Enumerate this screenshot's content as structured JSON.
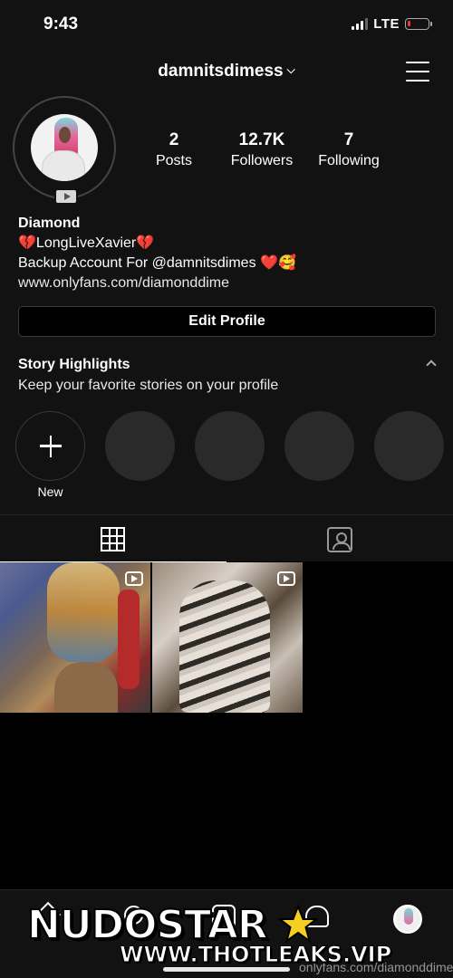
{
  "status_bar": {
    "time": "9:43",
    "network": "LTE"
  },
  "header": {
    "username": "damnitsdimess",
    "chevron": "⌄"
  },
  "stats": {
    "posts": {
      "value": "2",
      "label": "Posts"
    },
    "followers": {
      "value": "12.7K",
      "label": "Followers"
    },
    "following": {
      "value": "7",
      "label": "Following"
    }
  },
  "bio": {
    "name": "Diamond",
    "line1": "💔LongLiveXavier💔",
    "line2": "Backup Account For @damnitsdimes ❤️🥰",
    "link": "www.onlyfans.com/diamonddime"
  },
  "edit_profile_label": "Edit Profile",
  "highlights": {
    "title": "Story Highlights",
    "subtitle": "Keep your favorite stories on your profile",
    "new_label": "New"
  },
  "tabs": [
    {
      "name": "posts-grid",
      "icon": "grid-icon",
      "active": true
    },
    {
      "name": "tagged",
      "icon": "tagged-icon",
      "active": false
    }
  ],
  "posts": [
    {
      "type": "reel",
      "icon": "reel-icon"
    },
    {
      "type": "reel",
      "icon": "reel-icon"
    }
  ],
  "bottom_nav": {
    "icons": [
      "home-icon",
      "search-icon",
      "reels-icon",
      "heart-icon",
      "profile-avatar"
    ]
  },
  "watermark": {
    "logo": "NUDOSTAR",
    "url": "WWW.THOTLEAKS.VIP",
    "faint": "onlyfans.com/diamonddime"
  },
  "colors": {
    "background": "#000000",
    "surface": "#121212",
    "text": "#ffffff",
    "star": "#f5d020"
  }
}
